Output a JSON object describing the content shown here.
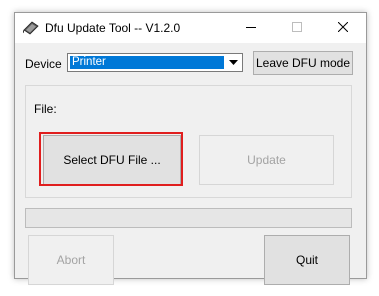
{
  "window": {
    "title": "Dfu Update Tool -- V1.2.0",
    "icon": "dfu-app-icon",
    "controls": {
      "minimize_icon": "minimize-icon",
      "maximize_icon": "maximize-icon",
      "close_icon": "close-icon"
    }
  },
  "device": {
    "label": "Device",
    "selected": "Printer",
    "leave_button": "Leave DFU mode"
  },
  "file": {
    "label": "File:",
    "select_button": "Select DFU File ...",
    "update_button": "Update",
    "update_enabled": false
  },
  "progress": {
    "value": 0
  },
  "actions": {
    "abort_button": "Abort",
    "abort_enabled": false,
    "quit_button": "Quit"
  },
  "colors": {
    "highlight": "#e01e1e",
    "selection": "#0078d7"
  }
}
